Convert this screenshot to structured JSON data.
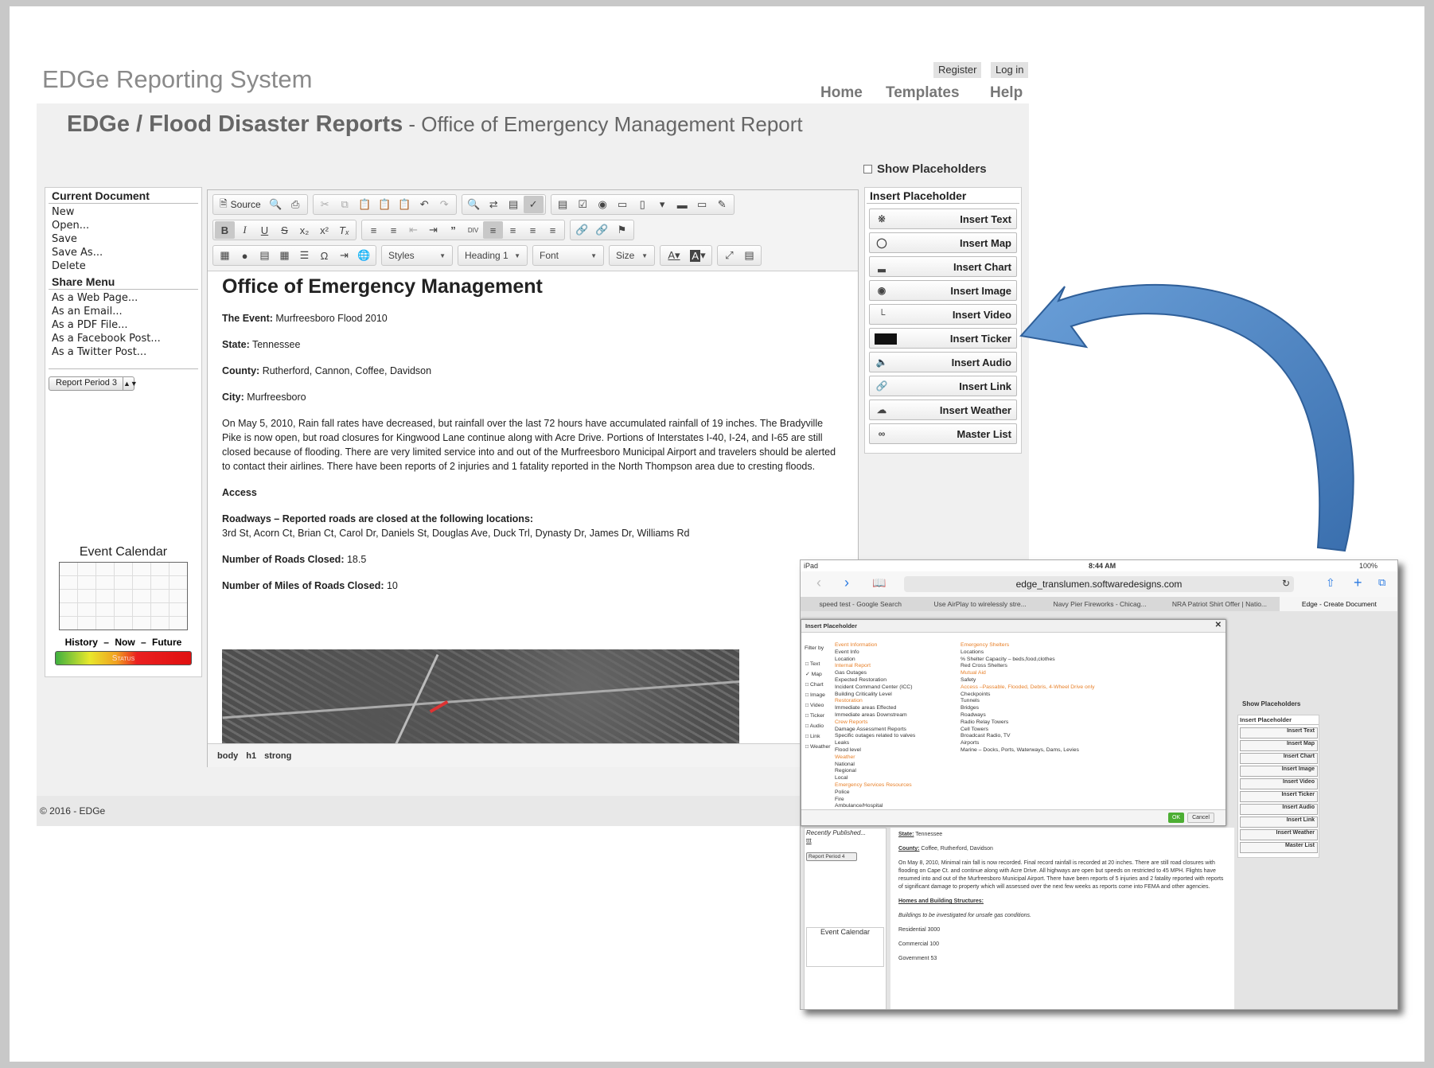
{
  "site": {
    "title": "EDGe Reporting System",
    "register": "Register",
    "login": "Log in"
  },
  "nav": {
    "home": "Home",
    "templates": "Templates",
    "help": "Help"
  },
  "heading": {
    "main": "EDGe / Flood Disaster Reports",
    "sub": " - Office of Emergency Management Report"
  },
  "show_placeholders": "Show Placeholders",
  "left": {
    "current_title": "Current Document",
    "current_items": [
      "New",
      "Open...",
      "Save",
      "Save As...",
      "Delete"
    ],
    "share_title": "Share Menu",
    "share_items": [
      "As a Web Page...",
      "As an Email...",
      "As a PDF File...",
      "As a Facebook Post...",
      "As a Twitter Post..."
    ],
    "period": "Report Period 3",
    "calendar_title": "Event Calendar",
    "history": "History –",
    "now": "Now –",
    "future": "Future",
    "status": "Status"
  },
  "toolbar": {
    "source": "Source",
    "styles": "Styles",
    "heading": "Heading 1",
    "font": "Font",
    "size": "Size"
  },
  "document": {
    "title": "Office of Emergency Management",
    "event_label": "The Event:",
    "event": " Murfreesboro Flood 2010",
    "state_label": "State:",
    "state": " Tennessee",
    "county_label": "County:",
    "county": " Rutherford, Cannon, Coffee, Davidson",
    "city_label": "City:",
    "city": " Murfreesboro",
    "body": "On May 5, 2010, Rain fall rates have decreased, but rainfall over the last 72 hours have accumulated rainfall of 19 inches. The Bradyville Pike is now open, but road closures for Kingwood Lane continue along with Acre Drive. Portions of Interstates I-40, I-24, and I-65 are still closed because of flooding. There are very limited service into and out of the Murfreesboro Municipal Airport and travelers should be alerted to contact their airlines. There have been reports of 2 injuries and 1 fatality reported in the North Thompson area due to cresting floods.",
    "access": "Access",
    "roadways_label": "Roadways – Reported roads are closed at the following locations:",
    "roadways": "3rd St, Acorn Ct, Brian Ct, Carol Dr, Daniels St, Douglas Ave, Duck Trl, Dynasty Dr, James Dr, Williams Rd",
    "roads_closed_label": "Number of Roads Closed:",
    "roads_closed": " 18.5",
    "miles_label": "Number of Miles of Roads Closed:",
    "miles": " 10"
  },
  "statusline": [
    "body",
    "h1",
    "strong"
  ],
  "copyright": "© 2016 - EDGe",
  "placeholder_panel": {
    "title": "Insert Placeholder",
    "buttons": [
      {
        "label": "Insert Text",
        "icon": "text-icon"
      },
      {
        "label": "Insert Map",
        "icon": "map-icon"
      },
      {
        "label": "Insert Chart",
        "icon": "chart-icon"
      },
      {
        "label": "Insert Image",
        "icon": "camera-icon"
      },
      {
        "label": "Insert Video",
        "icon": "video-icon"
      },
      {
        "label": "Insert Ticker",
        "icon": "ticker-icon"
      },
      {
        "label": "Insert Audio",
        "icon": "speaker-icon"
      },
      {
        "label": "Insert Link",
        "icon": "link-icon"
      },
      {
        "label": "Insert Weather",
        "icon": "weather-icon"
      },
      {
        "label": "Master List",
        "icon": "infinity-icon"
      }
    ]
  },
  "ipad": {
    "device": "iPad",
    "time": "8:44 AM",
    "battery": "100%",
    "url": "edge_translumen.softwaredesigns.com",
    "tabs": [
      "speed test - Google Search",
      "Use AirPlay to wirelessly stre...",
      "Navy Pier Fireworks - Chicag...",
      "NRA Patriot Shirt Offer | Natio...",
      "Edge - Create Document"
    ],
    "dialog_title": "Insert Placeholder",
    "filter_by": "Filter by",
    "filters": [
      "Text",
      "Map",
      "Chart",
      "Image",
      "Video",
      "Ticker",
      "Audio",
      "Link",
      "Weather"
    ],
    "col1": [
      {
        "t": "Event Information",
        "h": true
      },
      {
        "t": "Event Info"
      },
      {
        "t": "Location"
      },
      {
        "t": "Internal Report",
        "h": true
      },
      {
        "t": "Gas Outages"
      },
      {
        "t": "Expected Restoration"
      },
      {
        "t": "Incident Command Center (ICC)"
      },
      {
        "t": "Building Criticality Level"
      },
      {
        "t": "Restoration",
        "h": true
      },
      {
        "t": "Immediate areas Effected"
      },
      {
        "t": "Immediate areas Downstream"
      },
      {
        "t": "Crew Reports",
        "h": true
      },
      {
        "t": "Damage Assessment Reports"
      },
      {
        "t": "Specific outages related to valves"
      },
      {
        "t": "Leaks"
      },
      {
        "t": "Flood level"
      },
      {
        "t": "Weather",
        "h": true
      },
      {
        "t": "National"
      },
      {
        "t": "Regional"
      },
      {
        "t": "Local"
      },
      {
        "t": "Emergency Services Resources",
        "h": true
      },
      {
        "t": "Police"
      },
      {
        "t": "Fire"
      },
      {
        "t": "Ambulance/Hospital"
      }
    ],
    "col2": [
      {
        "t": "Emergency Shelters",
        "h": true
      },
      {
        "t": "Locations"
      },
      {
        "t": "% Shelter Capacity – beds,food,clothes"
      },
      {
        "t": "Red Cross Shelters"
      },
      {
        "t": "Mutual Aid",
        "h": true
      },
      {
        "t": "Safety"
      },
      {
        "t": "Access –Passable, Flooded, Debris, 4-Wheel Drive only",
        "h": true
      },
      {
        "t": "Checkpoints"
      },
      {
        "t": "Tunnels"
      },
      {
        "t": "Bridges"
      },
      {
        "t": "Roadways"
      },
      {
        "t": "Radio Relay Towers"
      },
      {
        "t": "Cell Towers"
      },
      {
        "t": "Broadcast Radio, TV"
      },
      {
        "t": "Airports"
      },
      {
        "t": "Marine – Docks, Ports, Waterways, Dams, Levies"
      }
    ],
    "ok": "OK",
    "cancel": "Cancel",
    "show_placeholders": "Show Placeholders",
    "insert_placeholder": "Insert Placeholder",
    "mini_buttons": [
      "Insert Text",
      "Insert Map",
      "Insert Chart",
      "Insert Image",
      "Insert Video",
      "Insert Ticker",
      "Insert Audio",
      "Insert Link",
      "Insert Weather",
      "Master List"
    ],
    "recently": "Recently Published...",
    "recent_item": "ttt",
    "period": "Report Period 4",
    "calendar": "Event Calendar",
    "state_label": "State:",
    "state": " Tennessee",
    "county_label": "County:",
    "county": " Coffee, Rutherford, Davidson",
    "body": "On May 8, 2010, Minimal rain fall is now recorded. Final record rainfall is recorded at 20 inches. There are still road closures with flooding on Cape Ct. and continue along with Acre Drive. All highways are open but speeds on restricted to 45 MPH. Flights have resumed into and out of the Murfreesboro Municipal Airport. There have been reports of 5 injuries and 2 fatality reported with reports of significant damage to property which will assessed over the next few weeks as reports come into FEMA and other agencies.",
    "homes": "Homes and Building Structures:",
    "investigate": "Buildings to be investigated for unsafe gas conditions.",
    "residential": "Residential 3000",
    "commercial": "Commercial 100",
    "government": "Government  53"
  },
  "colors": {
    "accent_orange": "#e8812a",
    "arrow_blue": "#4a7fbf",
    "ok_green": "#4cae33"
  }
}
